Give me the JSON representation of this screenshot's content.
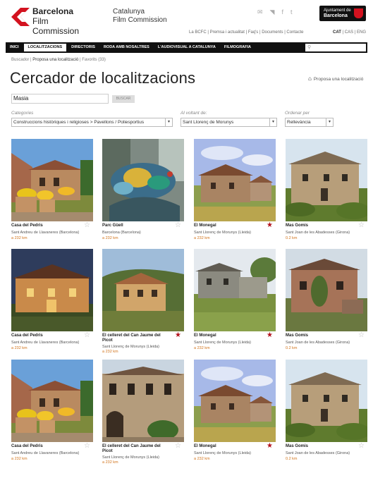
{
  "header": {
    "brand_line1": "Barcelona",
    "brand_line2": "Film Commission",
    "tagline_line1": "Catalunya",
    "tagline_line2": "Film Commission",
    "social_icons": [
      "mail-icon",
      "rss-icon",
      "facebook-icon",
      "twitter-icon"
    ],
    "ajuntament_line1": "Ajuntament de",
    "ajuntament_line2": "Barcelona",
    "top_links": "La BCFC  |  Premsa i actualitat  |  Faq's  |  Documents  |  Contacte",
    "lang_active": "CAT",
    "lang_rest": " | CAS | ENG"
  },
  "nav": {
    "items": [
      "INICI",
      "LOCALITZACIONS",
      "DIRECTORIS",
      "RODA AMB NOSALTRES",
      "L'AUDIOVISUAL A CATALUNYA",
      "FILMOGRAFIA"
    ],
    "active_index": 1,
    "search_placeholder": ""
  },
  "breadcrumb": {
    "first": "Buscador",
    "sep": " | ",
    "current": "Proposa una localització",
    "rest": " | Favorits (33)"
  },
  "page": {
    "title": "Cercador de localitzacions",
    "propose_link": "Proposa una localització"
  },
  "search": {
    "value": "Masia",
    "button": "BUSCAR"
  },
  "filters": {
    "category_label": "Categories",
    "category_value": "Construccions històriques i religioses > Pavellons / Poliesportius",
    "around_label": "Al voltant de:",
    "around_value": "Sant Llorenç de Morunys",
    "order_label": "Ordenar per",
    "order_value": "Rellevància"
  },
  "results": [
    {
      "name": "Casa del Pedris",
      "place": "Sant Andreu de Llavaneres (Barcelona)",
      "dist": "a 232 km",
      "fav": false,
      "img": "masia-flowers"
    },
    {
      "name": "Parc Güell",
      "place": "Barcelona (Barcelona)",
      "dist": "a 232 km",
      "fav": false,
      "img": "dragon"
    },
    {
      "name": "El Monegal",
      "place": "Sant Llorenç de Morunys (Lleida)",
      "dist": "a 232 km",
      "fav": true,
      "img": "farm-sky"
    },
    {
      "name": "Mas Gomis",
      "place": "Sant Joan de les Abadesses (Girona)",
      "dist": "0.2 km",
      "fav": false,
      "img": "stone-house"
    },
    {
      "name": "Casa del Pedris",
      "place": "Sant Andreu de Llavaneres (Barcelona)",
      "dist": "a 232 km",
      "fav": false,
      "img": "night-house"
    },
    {
      "name": "El celleret del Can Jaume del Picot",
      "place": "Sant Llorenç de Morunys (Lleida)",
      "dist": "a 232 km",
      "fav": true,
      "img": "hill-house"
    },
    {
      "name": "El Monegal",
      "place": "Sant Llorenç de Morunys (Lleida)",
      "dist": "a 232 km",
      "fav": true,
      "img": "gray-farm"
    },
    {
      "name": "Mas Gomis",
      "place": "Sant Joan de les Abadesses (Girona)",
      "dist": "0.2 km",
      "fav": false,
      "img": "ivy-house"
    },
    {
      "name": "Casa del Pedris",
      "place": "Sant Andreu de Llavaneres (Barcelona)",
      "dist": "a 232 km",
      "fav": false,
      "img": "masia-flowers"
    },
    {
      "name": "El celleret del Can Jaume del Picot",
      "place": "Sant Llorenç de Morunys (Lleida)",
      "dist": "a 232 km",
      "fav": false,
      "img": "street-house"
    },
    {
      "name": "El Monegal",
      "place": "Sant Llorenç de Morunys (Lleida)",
      "dist": "a 232 km",
      "fav": true,
      "img": "farm-sky"
    },
    {
      "name": "Mas Gomis",
      "place": "Sant Joan de les Abadesses (Girona)",
      "dist": "0.2 km",
      "fav": false,
      "img": "stone-house"
    }
  ],
  "colors": {
    "brand_red": "#d3121f",
    "nav_bg": "#111111",
    "distance": "#d1731a",
    "star_active": "#b3121c"
  }
}
